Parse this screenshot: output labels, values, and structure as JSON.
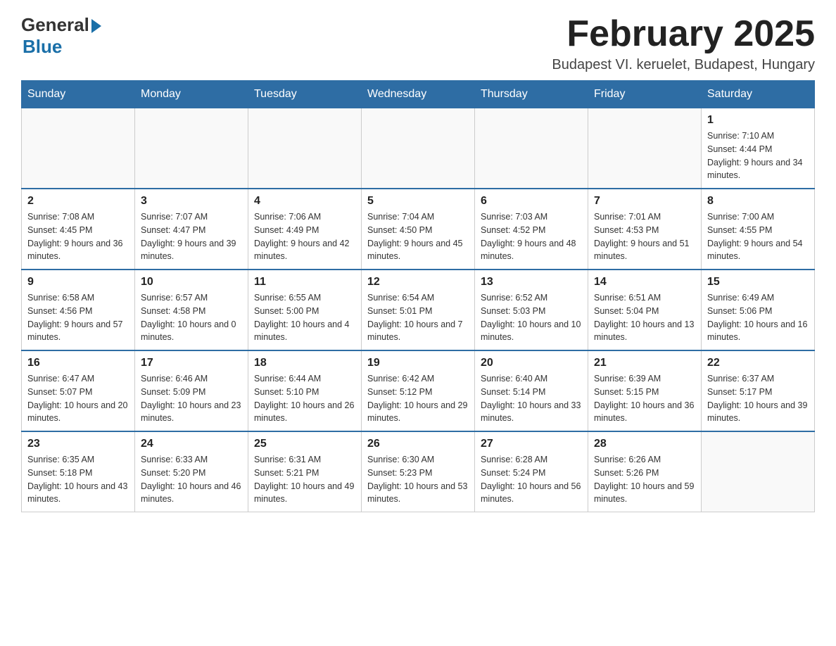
{
  "logo": {
    "general": "General",
    "blue": "Blue"
  },
  "title": "February 2025",
  "location": "Budapest VI. keruelet, Budapest, Hungary",
  "days_of_week": [
    "Sunday",
    "Monday",
    "Tuesday",
    "Wednesday",
    "Thursday",
    "Friday",
    "Saturday"
  ],
  "weeks": [
    [
      {
        "day": "",
        "info": ""
      },
      {
        "day": "",
        "info": ""
      },
      {
        "day": "",
        "info": ""
      },
      {
        "day": "",
        "info": ""
      },
      {
        "day": "",
        "info": ""
      },
      {
        "day": "",
        "info": ""
      },
      {
        "day": "1",
        "info": "Sunrise: 7:10 AM\nSunset: 4:44 PM\nDaylight: 9 hours and 34 minutes."
      }
    ],
    [
      {
        "day": "2",
        "info": "Sunrise: 7:08 AM\nSunset: 4:45 PM\nDaylight: 9 hours and 36 minutes."
      },
      {
        "day": "3",
        "info": "Sunrise: 7:07 AM\nSunset: 4:47 PM\nDaylight: 9 hours and 39 minutes."
      },
      {
        "day": "4",
        "info": "Sunrise: 7:06 AM\nSunset: 4:49 PM\nDaylight: 9 hours and 42 minutes."
      },
      {
        "day": "5",
        "info": "Sunrise: 7:04 AM\nSunset: 4:50 PM\nDaylight: 9 hours and 45 minutes."
      },
      {
        "day": "6",
        "info": "Sunrise: 7:03 AM\nSunset: 4:52 PM\nDaylight: 9 hours and 48 minutes."
      },
      {
        "day": "7",
        "info": "Sunrise: 7:01 AM\nSunset: 4:53 PM\nDaylight: 9 hours and 51 minutes."
      },
      {
        "day": "8",
        "info": "Sunrise: 7:00 AM\nSunset: 4:55 PM\nDaylight: 9 hours and 54 minutes."
      }
    ],
    [
      {
        "day": "9",
        "info": "Sunrise: 6:58 AM\nSunset: 4:56 PM\nDaylight: 9 hours and 57 minutes."
      },
      {
        "day": "10",
        "info": "Sunrise: 6:57 AM\nSunset: 4:58 PM\nDaylight: 10 hours and 0 minutes."
      },
      {
        "day": "11",
        "info": "Sunrise: 6:55 AM\nSunset: 5:00 PM\nDaylight: 10 hours and 4 minutes."
      },
      {
        "day": "12",
        "info": "Sunrise: 6:54 AM\nSunset: 5:01 PM\nDaylight: 10 hours and 7 minutes."
      },
      {
        "day": "13",
        "info": "Sunrise: 6:52 AM\nSunset: 5:03 PM\nDaylight: 10 hours and 10 minutes."
      },
      {
        "day": "14",
        "info": "Sunrise: 6:51 AM\nSunset: 5:04 PM\nDaylight: 10 hours and 13 minutes."
      },
      {
        "day": "15",
        "info": "Sunrise: 6:49 AM\nSunset: 5:06 PM\nDaylight: 10 hours and 16 minutes."
      }
    ],
    [
      {
        "day": "16",
        "info": "Sunrise: 6:47 AM\nSunset: 5:07 PM\nDaylight: 10 hours and 20 minutes."
      },
      {
        "day": "17",
        "info": "Sunrise: 6:46 AM\nSunset: 5:09 PM\nDaylight: 10 hours and 23 minutes."
      },
      {
        "day": "18",
        "info": "Sunrise: 6:44 AM\nSunset: 5:10 PM\nDaylight: 10 hours and 26 minutes."
      },
      {
        "day": "19",
        "info": "Sunrise: 6:42 AM\nSunset: 5:12 PM\nDaylight: 10 hours and 29 minutes."
      },
      {
        "day": "20",
        "info": "Sunrise: 6:40 AM\nSunset: 5:14 PM\nDaylight: 10 hours and 33 minutes."
      },
      {
        "day": "21",
        "info": "Sunrise: 6:39 AM\nSunset: 5:15 PM\nDaylight: 10 hours and 36 minutes."
      },
      {
        "day": "22",
        "info": "Sunrise: 6:37 AM\nSunset: 5:17 PM\nDaylight: 10 hours and 39 minutes."
      }
    ],
    [
      {
        "day": "23",
        "info": "Sunrise: 6:35 AM\nSunset: 5:18 PM\nDaylight: 10 hours and 43 minutes."
      },
      {
        "day": "24",
        "info": "Sunrise: 6:33 AM\nSunset: 5:20 PM\nDaylight: 10 hours and 46 minutes."
      },
      {
        "day": "25",
        "info": "Sunrise: 6:31 AM\nSunset: 5:21 PM\nDaylight: 10 hours and 49 minutes."
      },
      {
        "day": "26",
        "info": "Sunrise: 6:30 AM\nSunset: 5:23 PM\nDaylight: 10 hours and 53 minutes."
      },
      {
        "day": "27",
        "info": "Sunrise: 6:28 AM\nSunset: 5:24 PM\nDaylight: 10 hours and 56 minutes."
      },
      {
        "day": "28",
        "info": "Sunrise: 6:26 AM\nSunset: 5:26 PM\nDaylight: 10 hours and 59 minutes."
      },
      {
        "day": "",
        "info": ""
      }
    ]
  ]
}
